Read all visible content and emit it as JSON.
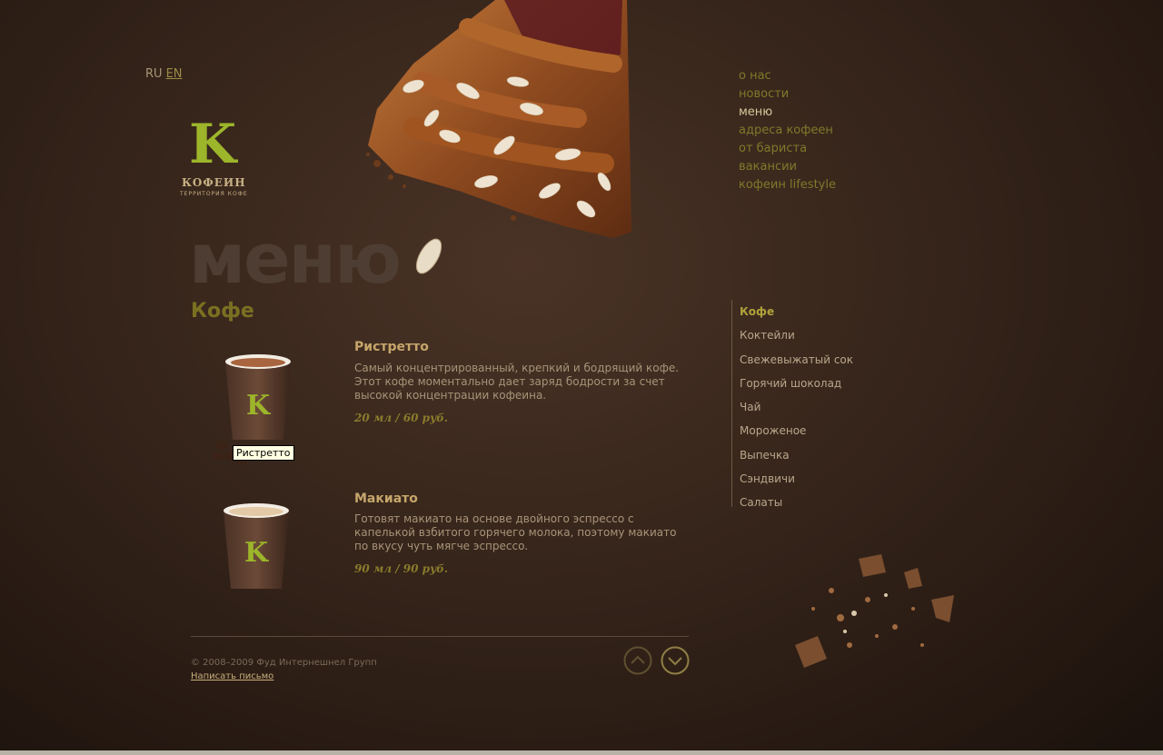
{
  "language": {
    "ru": "RU",
    "en": "EN"
  },
  "logo": {
    "letter": "K",
    "brand": "КОФЕИН",
    "tagline": "ТЕРРИТОРИЯ КОФЕ"
  },
  "top_nav": [
    {
      "label": "о нас"
    },
    {
      "label": "новости"
    },
    {
      "label": "меню",
      "active": true
    },
    {
      "label": "адреса кофеен"
    },
    {
      "label": "от бариста"
    },
    {
      "label": "вакансии"
    },
    {
      "label": "кофеин lifestyle"
    }
  ],
  "page_title": "меню",
  "section_title": "Кофе",
  "categories": [
    {
      "label": "Кофе",
      "active": true
    },
    {
      "label": "Коктейли"
    },
    {
      "label": "Свежевыжатый сок"
    },
    {
      "label": "Горячий шоколад"
    },
    {
      "label": "Чай"
    },
    {
      "label": "Мороженое"
    },
    {
      "label": "Выпечка"
    },
    {
      "label": "Сэндвичи"
    },
    {
      "label": "Салаты"
    }
  ],
  "products": [
    {
      "name": "Ристретто",
      "description": "Самый концентрированный, крепкий и бодрящий кофе. Этот кофе моментально дает заряд бодрости за счет высокой концентрации кофеина.",
      "price": "20 мл  / 60 руб."
    },
    {
      "name": "Макиато",
      "description": "Готовят макиато на основе двойного эспрессо с капелькой взбитого горячего молока, поэтому макиато по вкусу чуть мягче эспрессо.",
      "price": "90 мл  / 90 руб."
    }
  ],
  "tooltip": "Ристретто",
  "footer": {
    "copyright": "© 2008–2009 Фуд Интернешнел Групп",
    "mail_link": "Написать письмо"
  },
  "icons": {
    "arrow_up": "chevron-up-icon",
    "arrow_down": "chevron-down-icon"
  },
  "colors": {
    "accent_green": "#9cb52a",
    "nav_olive": "#7d7a2a",
    "background": "#3a281d"
  }
}
